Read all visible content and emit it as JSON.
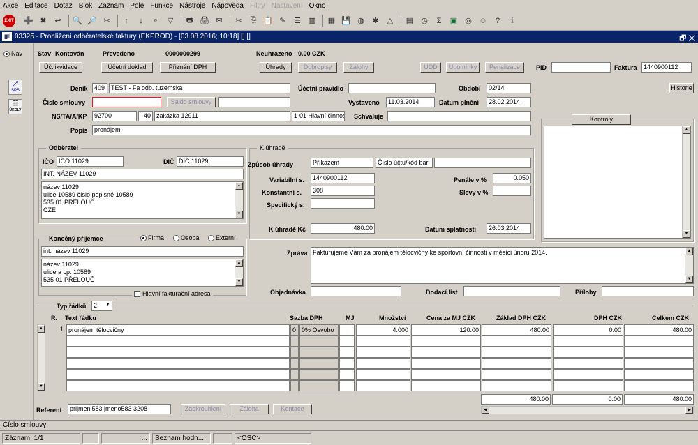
{
  "menu": [
    "Akce",
    "Editace",
    "Dotaz",
    "Blok",
    "Záznam",
    "Pole",
    "Funkce",
    "Nástroje",
    "Nápověda",
    "Filtry",
    "Nastavení",
    "Okno"
  ],
  "window": {
    "title": "03325 - Prohlížení odběratelské faktury (EKPROD) - [03.08.2016; 10:18] [] []",
    "logo": "IF",
    "controls": "🗗 ✕"
  },
  "left": {
    "nav": "Nav",
    "sps": "SPS",
    "ukoly": "ÚKOLY"
  },
  "header": {
    "stav_label": "Stav",
    "stav_value": "Kontován",
    "prevedeno_label": "Převedeno",
    "prevedeno_value": "0000000299",
    "neuhrazeno_label": "Neuhrazeno",
    "neuhrazeno_value": "0.00 CZK",
    "pid_label": "PID",
    "pid_value": "",
    "faktura_label": "Faktura",
    "faktura_value": "1440900112"
  },
  "buttons": {
    "uc_likvidace": "Úč.likvidace",
    "ucetni_doklad": "Účetní doklad",
    "priznani_dph": "Přiznání DPH",
    "uhrady": "Úhrady",
    "dobropisy": "Dobropisy",
    "zalohy": "Zálohy",
    "udd": "UDD",
    "upominky": "Upomínky",
    "penalizace": "Penalizace",
    "historie": "Historie",
    "saldo": "Saldo smlouvy",
    "kontroly": "Kontroly",
    "zaokrouhleni": "Zaokrouhlení",
    "zaloha": "Záloha",
    "kontace": "Kontace"
  },
  "form": {
    "denik_label": "Deník",
    "denik_code": "409",
    "denik_name": "TEST - Fa odb. tuzemská",
    "ucetni_pravidlo_label": "Účetní pravidlo",
    "ucetni_pravidlo_value": "",
    "obdobi_label": "Období",
    "obdobi_value": "02/14",
    "cislo_smlouvy_label": "Číslo smlouvy",
    "cislo_smlouvy_value": "",
    "vystaveno_label": "Vystaveno",
    "vystaveno_value": "11.03.2014",
    "datum_plneni_label": "Datum plnění",
    "datum_plneni_value": "28.02.2014",
    "ns_label": "NS/TA/A/KP",
    "ns_value": "92700",
    "ta_value": "40",
    "a_value": "zakázka 12911",
    "kp_value": "1-01 Hlavní činnos",
    "schvaluje_label": "Schvaluje",
    "schvaluje_value": "",
    "popis_label": "Popis",
    "popis_value": "pronájem"
  },
  "odberatel": {
    "title": "Odběratel",
    "ico_label": "IČO",
    "ico_value": "IČO 11029",
    "dic_label": "DIČ",
    "dic_value": "DIČ 11029",
    "name": "INT. NÁZEV 11029",
    "address": [
      "název 11029",
      "ulice 10589 číslo popisné 10589",
      "535 01 PŘELOUČ",
      "CZE"
    ]
  },
  "uhrada": {
    "title": "K úhradě",
    "zpusob_label": "Způsob úhrady",
    "zpusob_value": "Příkazem",
    "ucet_value": "Číslo účtu/kód bar",
    "ucet_extra": "",
    "vs_label": "Variabilní s.",
    "vs_value": "1440900112",
    "ks_label": "Konstantní s.",
    "ks_value": "308",
    "ss_label": "Specifický s.",
    "ss_value": "",
    "penale_label": "Penále v %",
    "penale_value": "0.050",
    "slevy_label": "Slevy v %",
    "slevy_value": "",
    "kuhrade_label": "K úhradě Kč",
    "kuhrade_value": "480.00",
    "splatnost_label": "Datum splatnosti",
    "splatnost_value": "26.03.2014"
  },
  "prijemce": {
    "title": "Konečný příjemce",
    "opt_firma": "Firma",
    "opt_osoba": "Osoba",
    "opt_externi": "Externí",
    "name": "int. název 11029",
    "address": [
      "název 11029",
      "ulice a cp. 10589",
      "535 01 PŘELOUČ"
    ],
    "hlavni_label": "Hlavní fakturační adresa"
  },
  "zprava": {
    "label": "Zpráva",
    "value": "Fakturujeme Vám za pronájem tělocvičny ke sportovní činnosti v měsíci únoru 2014."
  },
  "objednavka": {
    "label": "Objednávka",
    "value": "",
    "dodaci_label": "Dodací list",
    "dodaci_value": "",
    "prilohy_label": "Přílohy",
    "prilohy_value": ""
  },
  "grid": {
    "typ_label": "Typ řádků",
    "typ_value": "2",
    "columns": {
      "r": "Ř.",
      "text": "Text řádku",
      "sazba": "Sazba DPH",
      "mj": "MJ",
      "mnozstvi": "Množství",
      "cena": "Cena za MJ CZK",
      "zaklad": "Základ DPH CZK",
      "dph": "DPH CZK",
      "celkem": "Celkem CZK"
    },
    "rows": [
      {
        "r": "1",
        "text": "pronájem tělocvičny",
        "sazba_code": "0",
        "sazba": "0% Osvobo",
        "mj": "",
        "mnozstvi": "4.000",
        "cena": "120.00",
        "zaklad": "480.00",
        "dph": "0.00",
        "celkem": "480.00"
      }
    ],
    "totals": {
      "zaklad": "480.00",
      "dph": "0.00",
      "celkem": "480.00"
    }
  },
  "referent": {
    "label": "Referent",
    "value": "prijmeni583 jmeno583 3208"
  },
  "status": {
    "field": "Číslo smlouvy",
    "zaznam": "Záznam: 1/1",
    "seg3": "...",
    "seg4": "Seznam hodn...",
    "seg5": "<OSC>"
  }
}
